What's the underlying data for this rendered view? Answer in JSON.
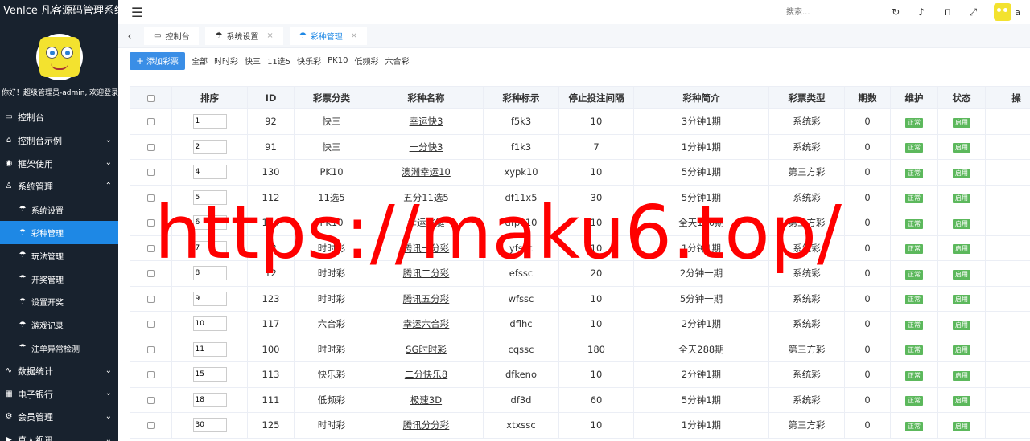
{
  "app": {
    "title": "Venlce 凡客源码管理系统",
    "welcome": "你好！超级管理员-admin, 欢迎登录"
  },
  "sidebar": {
    "items": [
      {
        "label": "控制台",
        "icon": "monitor-icon",
        "level": 1,
        "caret": ""
      },
      {
        "label": "控制台示例",
        "icon": "home-icon",
        "level": 1,
        "caret": "⌄"
      },
      {
        "label": "框架使用",
        "icon": "framework-icon",
        "level": 1,
        "caret": "⌄"
      },
      {
        "label": "系统管理",
        "icon": "user-icon",
        "level": 1,
        "caret": "⌃"
      },
      {
        "label": "系统设置",
        "icon": "umbrella-icon",
        "level": 2,
        "caret": ""
      },
      {
        "label": "彩种管理",
        "icon": "umbrella-icon",
        "level": 2,
        "caret": "",
        "active": true
      },
      {
        "label": "玩法管理",
        "icon": "umbrella-icon",
        "level": 2,
        "caret": ""
      },
      {
        "label": "开奖管理",
        "icon": "umbrella-icon",
        "level": 2,
        "caret": ""
      },
      {
        "label": "设置开奖",
        "icon": "umbrella-icon",
        "level": 2,
        "caret": ""
      },
      {
        "label": "游戏记录",
        "icon": "umbrella-icon",
        "level": 2,
        "caret": ""
      },
      {
        "label": "注单异常检测",
        "icon": "umbrella-icon",
        "level": 2,
        "caret": ""
      },
      {
        "label": "数据统计",
        "icon": "pulse-icon",
        "level": 1,
        "caret": "⌄"
      },
      {
        "label": "电子银行",
        "icon": "bank-icon",
        "level": 1,
        "caret": "⌄"
      },
      {
        "label": "会员管理",
        "icon": "gear-icon",
        "level": 1,
        "caret": "⌄"
      },
      {
        "label": "真人视讯",
        "icon": "video-icon",
        "level": 1,
        "caret": "⌄"
      }
    ]
  },
  "header": {
    "search_placeholder": "搜索...",
    "user_initial": "a"
  },
  "tabs": [
    {
      "label": "控制台",
      "icon": "monitor-icon",
      "closable": false,
      "active": false
    },
    {
      "label": "系统设置",
      "icon": "umbrella-icon",
      "closable": true,
      "active": false
    },
    {
      "label": "彩种管理",
      "icon": "umbrella-icon",
      "closable": true,
      "active": true
    }
  ],
  "toolbar": {
    "add_label": "添加彩票",
    "filters": [
      "全部",
      "时时彩",
      "快三",
      "11选5",
      "快乐彩",
      "PK10",
      "低频彩",
      "六合彩"
    ]
  },
  "table": {
    "columns": [
      "排序",
      "ID",
      "彩票分类",
      "彩种名称",
      "彩种标示",
      "停止投注间隔",
      "彩种简介",
      "彩票类型",
      "期数",
      "维护",
      "状态",
      "操"
    ],
    "rows": [
      {
        "sort": "1",
        "id": "92",
        "category": "快三",
        "name": "幸运快3",
        "code": "f5k3",
        "interval": "10",
        "intro": "3分钟1期",
        "type": "系统彩",
        "periods": "0",
        "maint": "正常",
        "status": "启用"
      },
      {
        "sort": "2",
        "id": "91",
        "category": "快三",
        "name": "一分快3",
        "code": "f1k3",
        "interval": "7",
        "intro": "1分钟1期",
        "type": "系统彩",
        "periods": "0",
        "maint": "正常",
        "status": "启用"
      },
      {
        "sort": "4",
        "id": "130",
        "category": "PK10",
        "name": "澳洲幸运10",
        "code": "xypk10",
        "interval": "10",
        "intro": "5分钟1期",
        "type": "第三方彩",
        "periods": "0",
        "maint": "正常",
        "status": "启用"
      },
      {
        "sort": "5",
        "id": "112",
        "category": "11选5",
        "name": "五分11选5",
        "code": "df11x5",
        "interval": "30",
        "intro": "5分钟1期",
        "type": "系统彩",
        "periods": "0",
        "maint": "正常",
        "status": "启用"
      },
      {
        "sort": "6",
        "id": "114",
        "category": "PK10",
        "name": "幸运飞艇",
        "code": "dfpk10",
        "interval": "10",
        "intro": "全天180期",
        "type": "第三方彩",
        "periods": "0",
        "maint": "正常",
        "status": "启用"
      },
      {
        "sort": "7",
        "id": "12",
        "category": "时时彩",
        "name": "腾讯一分彩",
        "code": "yfssc",
        "interval": "10",
        "intro": "1分钟1期",
        "type": "系统彩",
        "periods": "0",
        "maint": "正常",
        "status": "启用"
      },
      {
        "sort": "8",
        "id": "12",
        "category": "时时彩",
        "name": "腾讯二分彩",
        "code": "efssc",
        "interval": "20",
        "intro": "2分钟一期",
        "type": "系统彩",
        "periods": "0",
        "maint": "正常",
        "status": "启用"
      },
      {
        "sort": "9",
        "id": "123",
        "category": "时时彩",
        "name": "腾讯五分彩",
        "code": "wfssc",
        "interval": "10",
        "intro": "5分钟一期",
        "type": "系统彩",
        "periods": "0",
        "maint": "正常",
        "status": "启用"
      },
      {
        "sort": "10",
        "id": "117",
        "category": "六合彩",
        "name": "幸运六合彩",
        "code": "dflhc",
        "interval": "10",
        "intro": "2分钟1期",
        "type": "系统彩",
        "periods": "0",
        "maint": "正常",
        "status": "启用"
      },
      {
        "sort": "11",
        "id": "100",
        "category": "时时彩",
        "name": "SG时时彩",
        "code": "cqssc",
        "interval": "180",
        "intro": "全天288期",
        "type": "第三方彩",
        "periods": "0",
        "maint": "正常",
        "status": "启用"
      },
      {
        "sort": "15",
        "id": "113",
        "category": "快乐彩",
        "name": "二分快乐8",
        "code": "dfkeno",
        "interval": "10",
        "intro": "2分钟1期",
        "type": "系统彩",
        "periods": "0",
        "maint": "正常",
        "status": "启用"
      },
      {
        "sort": "18",
        "id": "111",
        "category": "低频彩",
        "name": "极速3D",
        "code": "df3d",
        "interval": "60",
        "intro": "5分钟1期",
        "type": "系统彩",
        "periods": "0",
        "maint": "正常",
        "status": "启用"
      },
      {
        "sort": "30",
        "id": "125",
        "category": "时时彩",
        "name": "腾讯分分彩",
        "code": "xtxssc",
        "interval": "10",
        "intro": "1分钟1期",
        "type": "第三方彩",
        "periods": "0",
        "maint": "正常",
        "status": "启用"
      }
    ]
  },
  "watermark": "https://maku6.top/",
  "colors": {
    "sidebar_bg": "#18222e",
    "accent": "#1e88e5",
    "badge_green": "#5cb85c",
    "watermark": "#ff0000"
  }
}
